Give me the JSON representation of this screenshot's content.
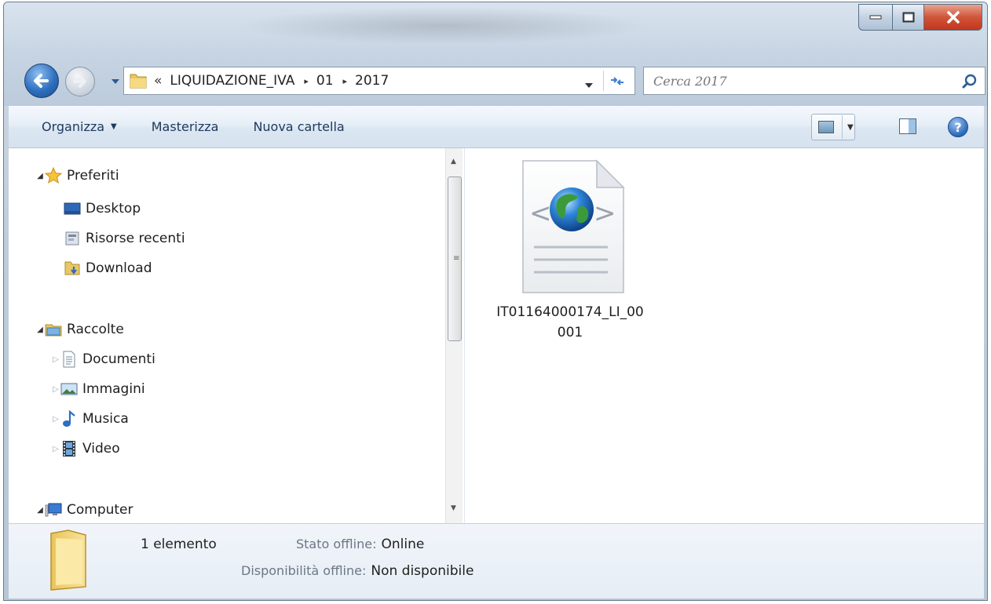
{
  "window": {
    "caption_buttons": [
      "minimize",
      "maximize",
      "close"
    ]
  },
  "address": {
    "overflow": "«",
    "crumbs": [
      "LIQUIDAZIONE_IVA",
      "01",
      "2017"
    ],
    "separator": "▸"
  },
  "search": {
    "placeholder": "Cerca 2017"
  },
  "toolbar": {
    "organize": "Organizza",
    "burn": "Masterizza",
    "new_folder": "Nuova cartella",
    "help": "?"
  },
  "nav": {
    "favorites": {
      "label": "Preferiti",
      "items": [
        "Desktop",
        "Risorse recenti",
        "Download"
      ]
    },
    "libraries": {
      "label": "Raccolte",
      "items": [
        "Documenti",
        "Immagini",
        "Musica",
        "Video"
      ]
    },
    "computer": {
      "label": "Computer"
    }
  },
  "files": [
    {
      "name": "IT01164000174_LI_00001",
      "icon": "html-document-globe-icon"
    }
  ],
  "details": {
    "count": "1 elemento",
    "offline_status_label": "Stato offline:",
    "offline_status_value": "Online",
    "offline_availability_label": "Disponibilità offline:",
    "offline_availability_value": "Non disponibile"
  },
  "colors": {
    "command_bar_text": "#1e395b",
    "close_button": "#c2361c",
    "accent_blue": "#2e6fbf"
  }
}
